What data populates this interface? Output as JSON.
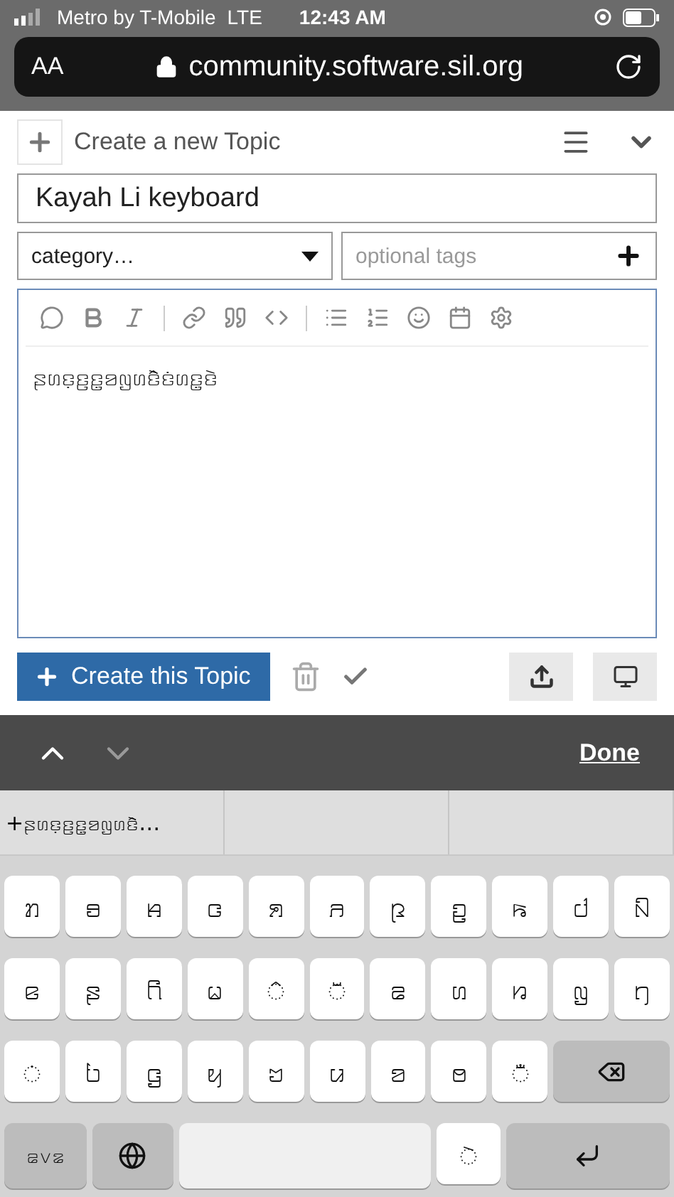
{
  "status_bar": {
    "carrier": "Metro by T-Mobile",
    "network": "LTE",
    "time": "12:43 AM"
  },
  "address_bar": {
    "text_size": "AA",
    "url": "community.software.sil.org"
  },
  "composer": {
    "heading": "Create a new Topic",
    "title": {
      "value": "Kayah Li keyboard"
    },
    "category": {
      "value": "category…"
    },
    "tags": {
      "placeholder": "optional tags"
    },
    "body": "ꤔꤛꤢ꤫ꤢ꤬ꤢ꤭ꤤꤜꤛꤢꤧꤨꤢꤦꤛꤢ꤭ꤢꤧ",
    "submit": "Create this Topic"
  },
  "keyboard_toolbar": {
    "done": "Done"
  },
  "suggestions": [
    "+ꤔꤛꤢ꤫ꤢ꤬ꤢ꤭ꤤꤜꤛꤢꤧꤨ…"
  ],
  "keyboard": {
    "rows": [
      {
        "keys": [
          {
            "kind": "char",
            "label": "ꤊ"
          },
          {
            "kind": "char",
            "label": "ꤋ"
          },
          {
            "kind": "char",
            "label": "ꤌ"
          },
          {
            "kind": "char",
            "label": "ꤍ"
          },
          {
            "kind": "char",
            "label": "ꤎ"
          },
          {
            "kind": "char",
            "label": "ꤏ"
          },
          {
            "kind": "char",
            "label": "ꤐ"
          },
          {
            "kind": "char",
            "label": "ꤑ"
          },
          {
            "kind": "char",
            "label": "ꤒ"
          },
          {
            "kind": "char",
            "label": "ꤓ"
          },
          {
            "kind": "char",
            "label": "ꤡ"
          }
        ]
      },
      {
        "keys": [
          {
            "kind": "char",
            "label": "ꤕ"
          },
          {
            "kind": "char",
            "label": "ꤔ"
          },
          {
            "kind": "char",
            "label": "ꤖ"
          },
          {
            "kind": "char",
            "label": "ꤗ"
          },
          {
            "kind": "char",
            "label": "◌ꤨ"
          },
          {
            "kind": "char",
            "label": "◌ꤩ"
          },
          {
            "kind": "char",
            "label": "ꤘ"
          },
          {
            "kind": "char",
            "label": "ꤛ"
          },
          {
            "kind": "char",
            "label": "ꤙ"
          },
          {
            "kind": "char",
            "label": "ꤜ"
          },
          {
            "kind": "char",
            "label": "ꤚ"
          }
        ]
      },
      {
        "keys": [
          {
            "kind": "char",
            "label": "◌ꤦ"
          },
          {
            "kind": "char",
            "label": "ꤝ"
          },
          {
            "kind": "char",
            "label": "ꤞ"
          },
          {
            "kind": "char",
            "label": "ꤟ"
          },
          {
            "kind": "char",
            "label": "ꤠ"
          },
          {
            "kind": "char",
            "label": "ꤣ"
          },
          {
            "kind": "char",
            "label": "ꤤ"
          },
          {
            "kind": "char",
            "label": "ꤥ"
          },
          {
            "kind": "char",
            "label": "◌ꤪ"
          },
          {
            "kind": "backspace"
          }
        ]
      },
      {
        "keys": [
          {
            "kind": "numbers",
            "label": "꤁꤂꤃"
          },
          {
            "kind": "globe"
          },
          {
            "kind": "space"
          },
          {
            "kind": "char",
            "label": "◌ꤧ"
          },
          {
            "kind": "return"
          }
        ]
      }
    ]
  }
}
